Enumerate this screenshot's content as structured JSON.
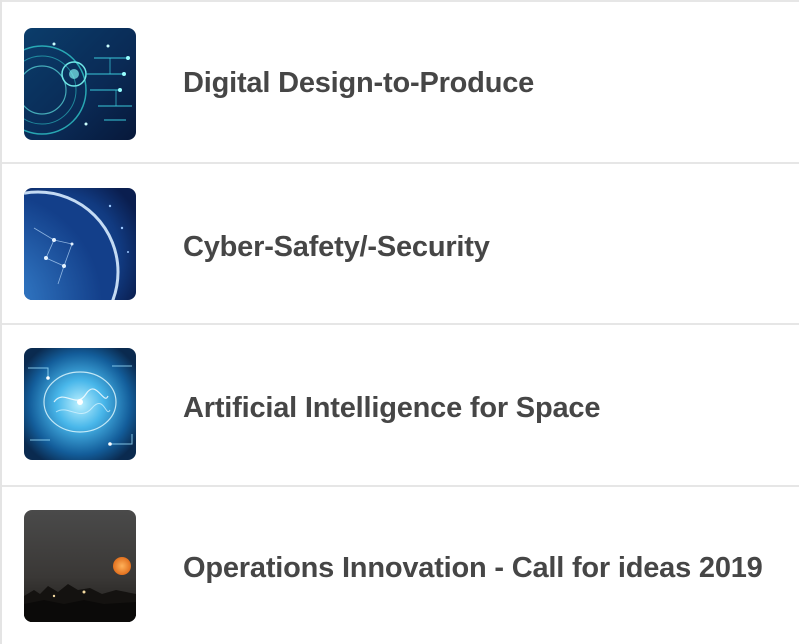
{
  "topics": [
    {
      "label": "Digital Design-to-Produce",
      "thumbnail_icon": "digital-circuit-thumbnail-icon"
    },
    {
      "label": "Cyber-Safety/-Security",
      "thumbnail_icon": "earth-network-thumbnail-icon"
    },
    {
      "label": "Artificial Intelligence for Space",
      "thumbnail_icon": "ai-brain-thumbnail-icon"
    },
    {
      "label": "Operations Innovation - Call for ideas 2019",
      "thumbnail_icon": "night-moon-thumbnail-icon"
    }
  ],
  "colors": {
    "label_text": "#464646",
    "divider": "#e6e6e6",
    "background": "#ffffff"
  }
}
